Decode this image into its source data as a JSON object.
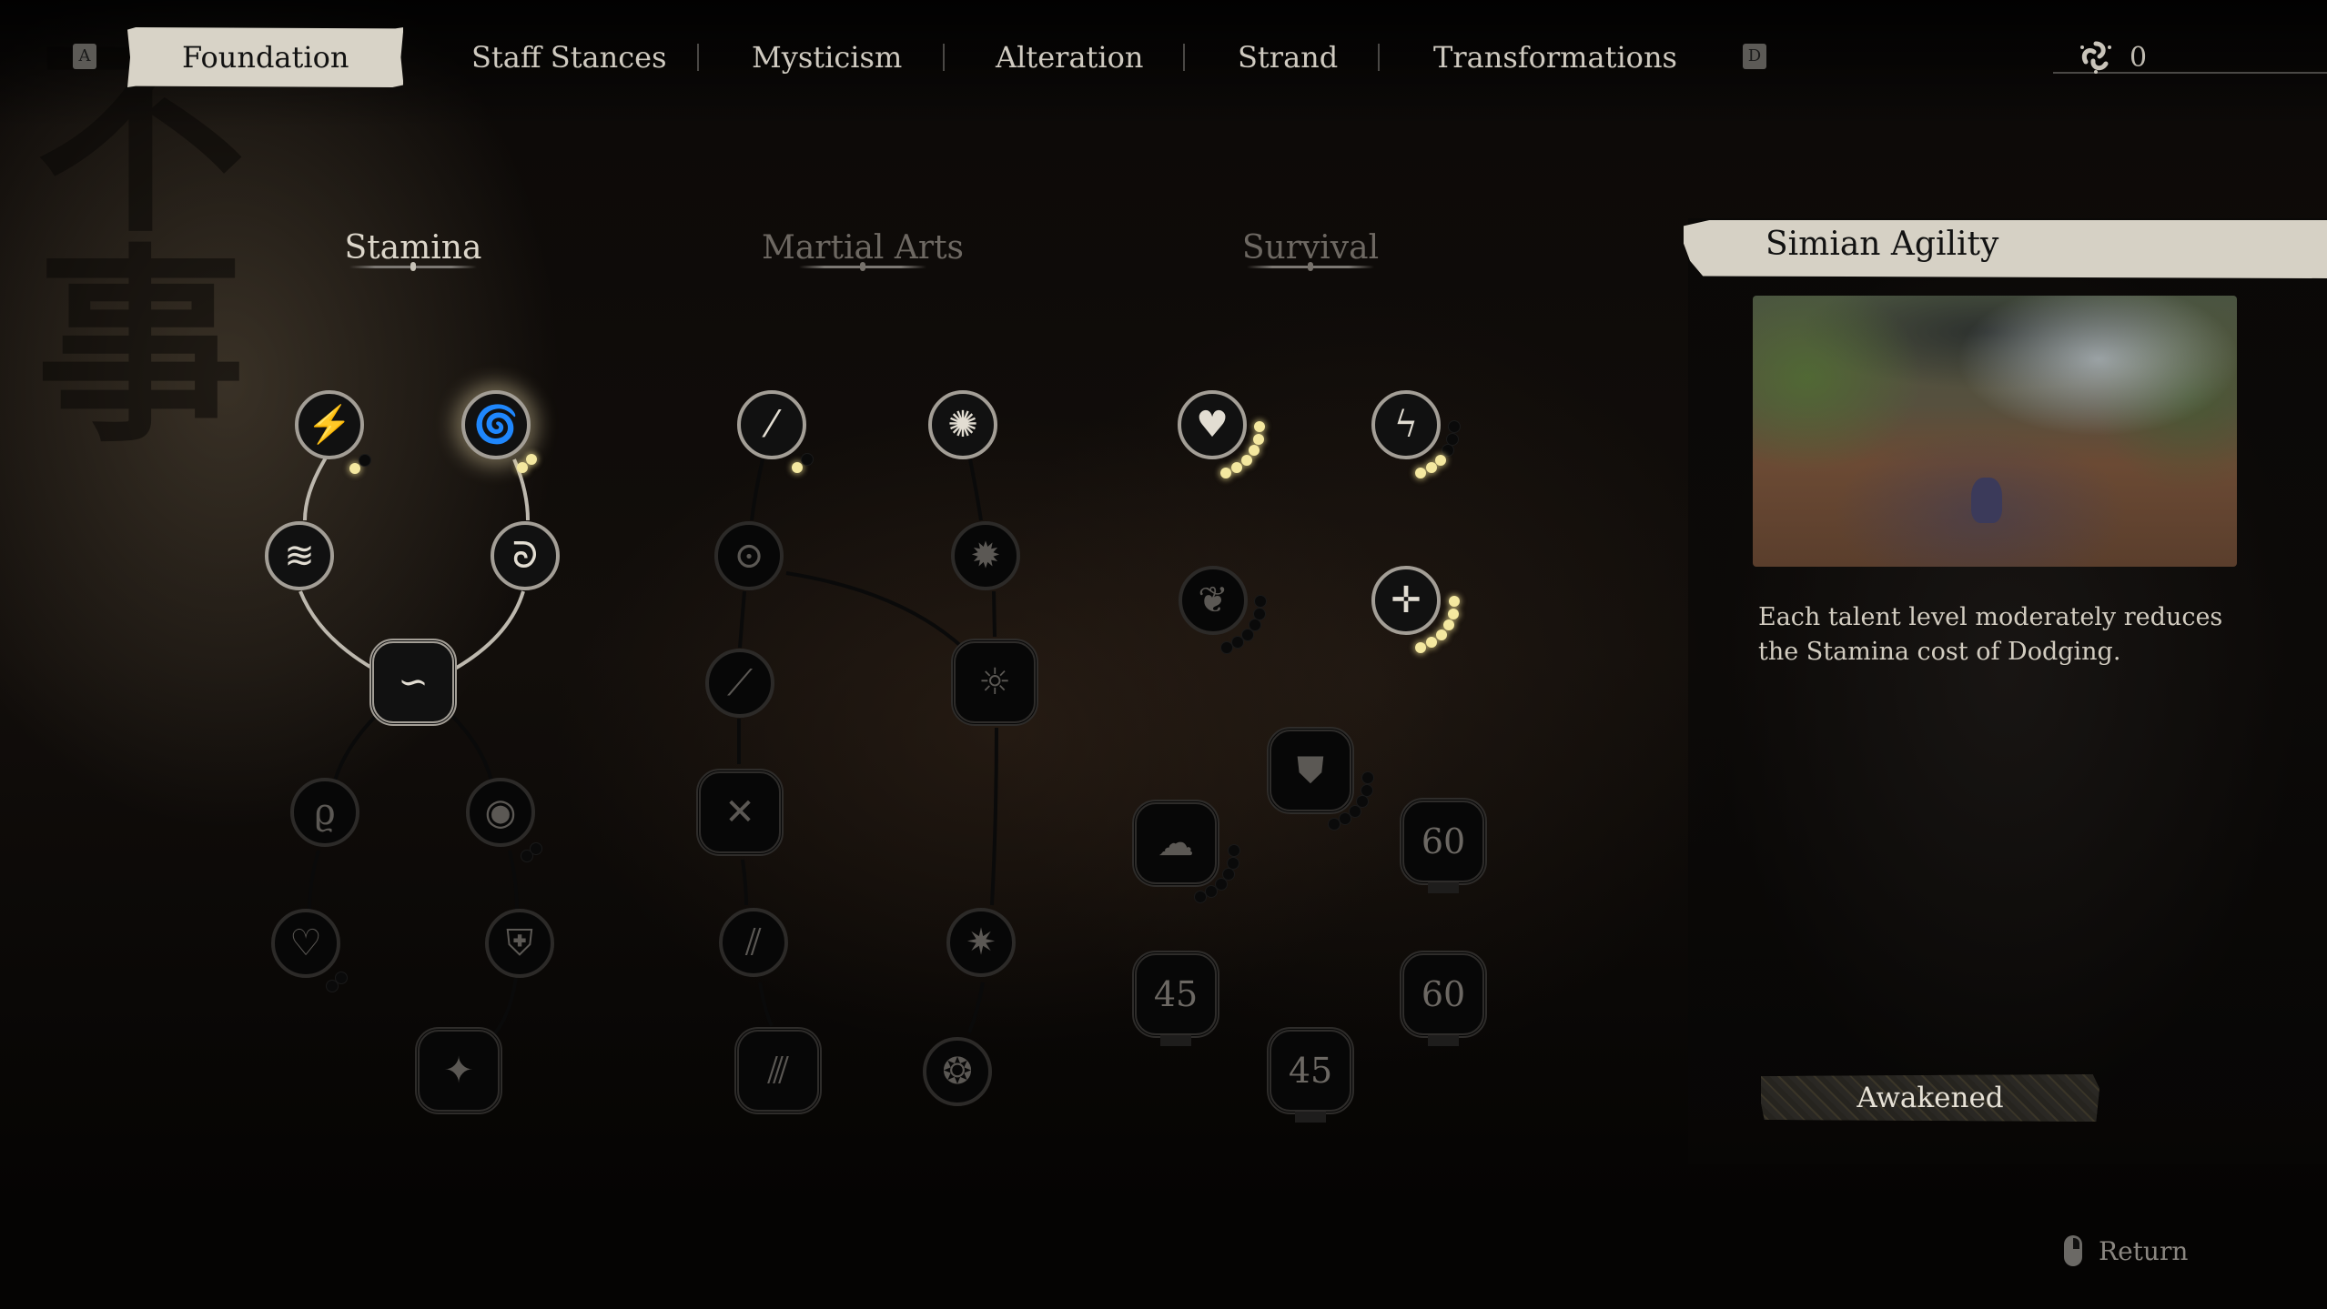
{
  "tabs": {
    "left_key": "A",
    "right_key": "D",
    "items": [
      {
        "label": "Foundation",
        "active": true
      },
      {
        "label": "Staff Stances",
        "active": false
      },
      {
        "label": "Mysticism",
        "active": false
      },
      {
        "label": "Alteration",
        "active": false
      },
      {
        "label": "Strand",
        "active": false
      },
      {
        "label": "Transformations",
        "active": false
      }
    ]
  },
  "currency": {
    "icon": "spark-triskelion-icon",
    "value": "0"
  },
  "background": {
    "calligraphy": "不事"
  },
  "sections": [
    {
      "title": "Stamina",
      "active": true
    },
    {
      "title": "Martial Arts",
      "active": false
    },
    {
      "title": "Survival",
      "active": false
    }
  ],
  "stamina_nodes": [
    {
      "id": "s1",
      "glyph": "⚡",
      "icon": "leaping-monkey-icon",
      "state": "unlocked",
      "level": 1,
      "max": 2
    },
    {
      "id": "s2",
      "glyph": "🌀",
      "icon": "swirl-spark-icon",
      "state": "unlocked",
      "selected": true,
      "level": 2,
      "max": 2
    },
    {
      "id": "s3",
      "glyph": "≋",
      "icon": "dash-arrows-icon",
      "state": "unlocked"
    },
    {
      "id": "s4",
      "glyph": "ᘐ",
      "icon": "wind-swirl-icon",
      "state": "unlocked"
    },
    {
      "id": "s5",
      "glyph": "∽",
      "icon": "staff-swirl-icon",
      "state": "unlocked",
      "shape": "big"
    },
    {
      "id": "s6",
      "glyph": "ϱ",
      "icon": "flame-wisp-icon",
      "state": "locked"
    },
    {
      "id": "s7",
      "glyph": "◉",
      "icon": "meditating-figure-icon",
      "state": "locked",
      "level": 0,
      "max": 2
    },
    {
      "id": "s8",
      "glyph": "♡",
      "icon": "cracked-heart-icon",
      "state": "locked",
      "level": 0,
      "max": 2
    },
    {
      "id": "s9",
      "glyph": "⛨",
      "icon": "shielded-figure-icon",
      "state": "locked"
    },
    {
      "id": "s10",
      "glyph": "✦",
      "icon": "shattering-figure-icon",
      "state": "locked",
      "shape": "big"
    }
  ],
  "martial_nodes": [
    {
      "id": "m1",
      "glyph": "⁄",
      "icon": "staff-strike-icon",
      "state": "unlocked",
      "level": 1,
      "max": 2
    },
    {
      "id": "m2",
      "glyph": "✺",
      "icon": "spinning-wheel-icon",
      "state": "unlocked"
    },
    {
      "id": "m3",
      "glyph": "⊙",
      "icon": "staff-orb-icon",
      "state": "locked"
    },
    {
      "id": "m4",
      "glyph": "✹",
      "icon": "vortex-wheel-icon",
      "state": "locked"
    },
    {
      "id": "m5",
      "glyph": "⟋",
      "icon": "staff-thrust-icon",
      "state": "locked"
    },
    {
      "id": "m6",
      "glyph": "☼",
      "icon": "sun-burst-icon",
      "state": "locked",
      "shape": "big"
    },
    {
      "id": "m7",
      "glyph": "✕",
      "icon": "scattered-staves-icon",
      "state": "locked",
      "shape": "big"
    },
    {
      "id": "m8",
      "glyph": "⫽",
      "icon": "staff-parry-icon",
      "state": "locked"
    },
    {
      "id": "m9",
      "glyph": "✷",
      "icon": "impact-burst-icon",
      "state": "locked"
    },
    {
      "id": "m10",
      "glyph": "⫻",
      "icon": "staff-sweep-icon",
      "state": "locked",
      "shape": "big"
    },
    {
      "id": "m11",
      "glyph": "❂",
      "icon": "spiral-vortex-icon",
      "state": "locked"
    }
  ],
  "survival_nodes": [
    {
      "id": "v1",
      "glyph": "♥",
      "icon": "heart-icon",
      "state": "unlocked",
      "level": 6,
      "max": 6
    },
    {
      "id": "v2",
      "glyph": "ϟ",
      "icon": "lightning-rune-icon",
      "state": "unlocked",
      "level": 3,
      "max": 6
    },
    {
      "id": "v3",
      "glyph": "❦",
      "icon": "ornate-scroll-icon",
      "state": "locked",
      "level": 0,
      "max": 6
    },
    {
      "id": "v4",
      "glyph": "✛",
      "icon": "star-flash-icon",
      "state": "unlocked",
      "level": 6,
      "max": 6
    },
    {
      "id": "v5",
      "glyph": "⛊",
      "icon": "armor-crest-icon",
      "state": "locked",
      "shape": "big",
      "level": 0,
      "max": 6
    },
    {
      "id": "v6",
      "glyph": "☁",
      "icon": "cloud-swirl-icon",
      "state": "locked",
      "shape": "big",
      "level": 0,
      "max": 6
    },
    {
      "id": "v7",
      "label": "60",
      "state": "level-locked",
      "shape": "big"
    },
    {
      "id": "v8",
      "label": "45",
      "state": "level-locked",
      "shape": "big"
    },
    {
      "id": "v9",
      "label": "60",
      "state": "level-locked",
      "shape": "big"
    },
    {
      "id": "v10",
      "label": "45",
      "state": "level-locked",
      "shape": "big"
    }
  ],
  "detail": {
    "title": "Simian Agility",
    "description": "Each talent level moderately reduces the Stamina cost of Dodging.",
    "status": "Awakened",
    "preview_alt": "character dodging on a dirt path in a forest"
  },
  "footer": {
    "return_label": "Return",
    "return_icon": "mouse-right-click-icon"
  },
  "colors": {
    "lit_dot": "#f4e8a0",
    "active_tab_bg": "#d8d3c7",
    "panel_title_bg": "#d6d1c5"
  }
}
